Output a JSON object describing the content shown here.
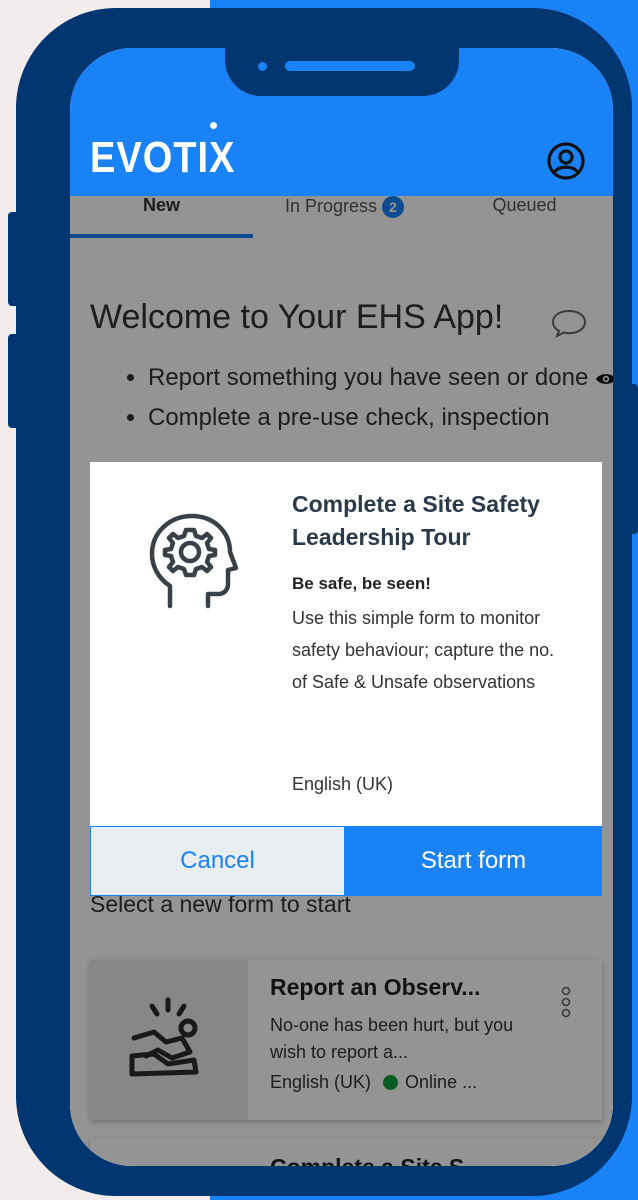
{
  "app": {
    "logo_text": "EVOTIX",
    "brand_color": "#1a82f7",
    "frame_color": "#013670"
  },
  "header": {
    "profile_icon": "user-circle-icon"
  },
  "tabs": [
    {
      "label": "New",
      "active": true
    },
    {
      "label": "In Progress",
      "badge": "2"
    },
    {
      "label": "Queued"
    }
  ],
  "welcome": {
    "title": "Welcome to Your EHS App!",
    "icon": "speech-bubble-icon",
    "bullets": [
      "Report something you have seen or done",
      "Complete a pre-use check, inspection"
    ]
  },
  "modal": {
    "icon": "head-gear-icon",
    "title": "Complete a Site Safety Leadership Tour",
    "subtitle": "Be safe, be seen!",
    "description": "Use this simple form to monitor safety behaviour; capture the no. of Safe & Unsafe observations",
    "language": "English (UK)",
    "cancel_label": "Cancel",
    "start_label": "Start form"
  },
  "list": {
    "label": "Select a new form to start",
    "cards": [
      {
        "title": "Report an Observ...",
        "description": "No-one has been hurt, but you wish to report a...",
        "language": "English (UK)",
        "status": "Online ...",
        "status_color": "#0f9d3a",
        "icon": "person-slip-icon"
      },
      {
        "title": "Complete a Site S..."
      }
    ]
  }
}
